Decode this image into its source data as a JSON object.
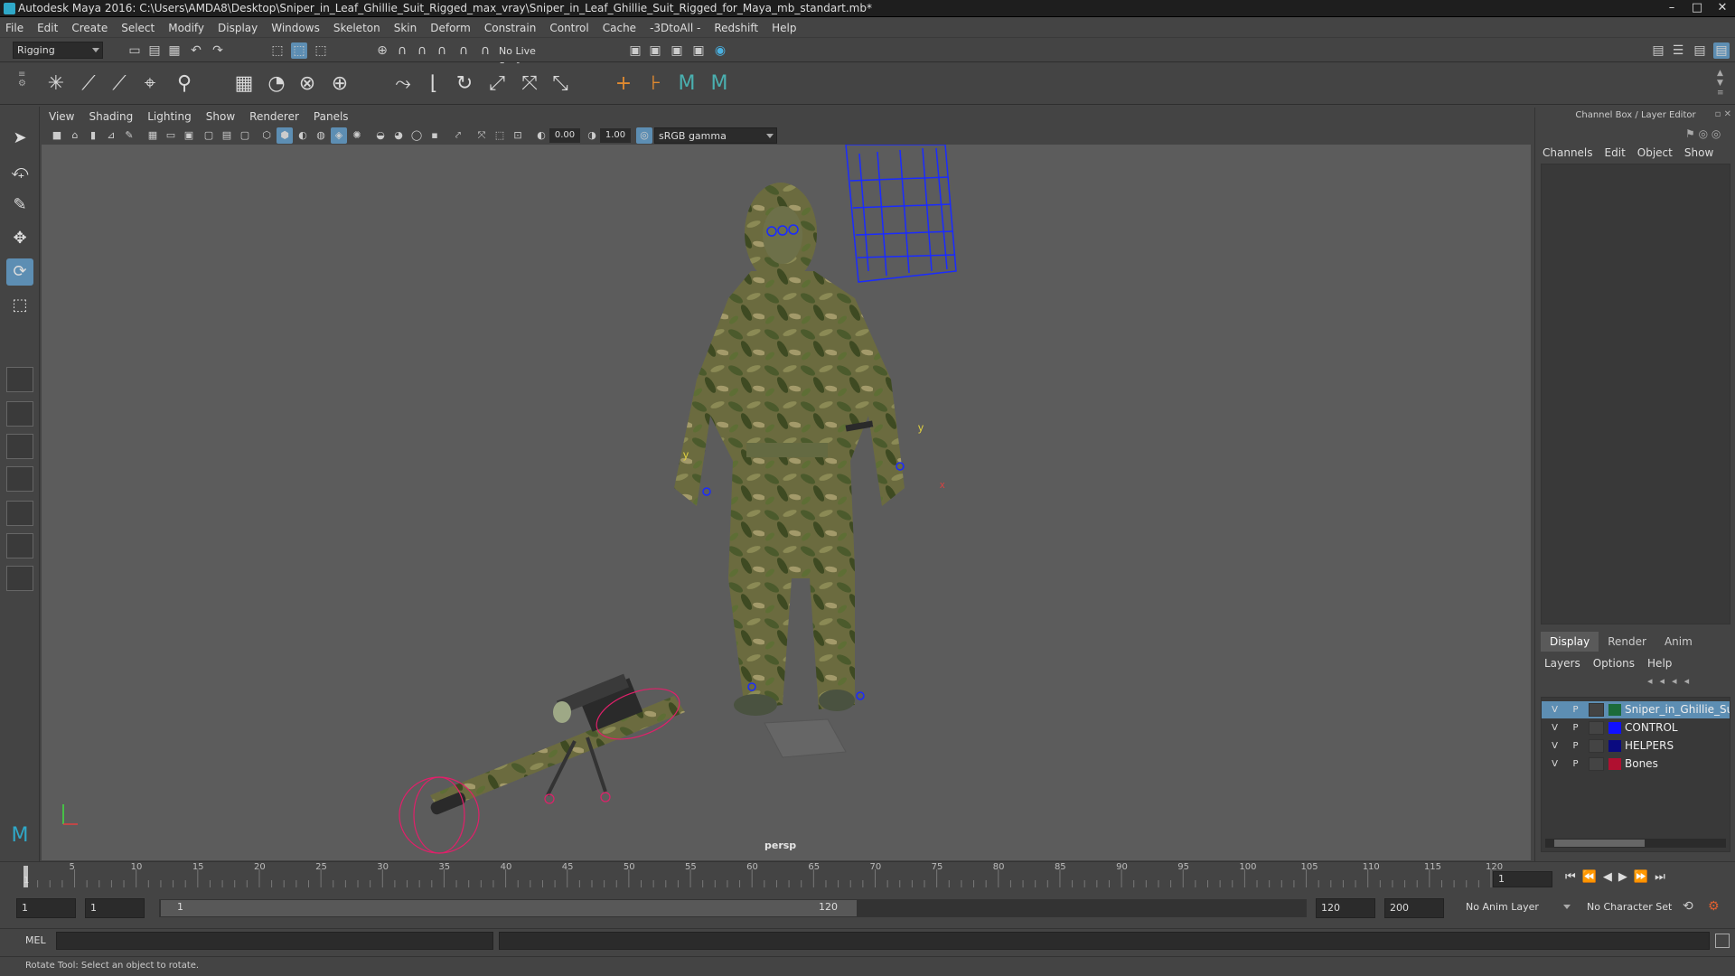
{
  "window": {
    "title": "Autodesk Maya 2016: C:\\Users\\AMDA8\\Desktop\\Sniper_in_Leaf_Ghillie_Suit_Rigged_max_vray\\Sniper_in_Leaf_Ghillie_Suit_Rigged_for_Maya_mb_standart.mb*"
  },
  "menus": [
    "File",
    "Edit",
    "Create",
    "Select",
    "Modify",
    "Display",
    "Windows",
    "Skeleton",
    "Skin",
    "Deform",
    "Constrain",
    "Control",
    "Cache",
    "-3DtoAll -",
    "Redshift",
    "Help"
  ],
  "statusline": {
    "menuset": "Rigging",
    "live_surface": "No Live Surface"
  },
  "viewport": {
    "menus": [
      "View",
      "Shading",
      "Lighting",
      "Show",
      "Renderer",
      "Panels"
    ],
    "exposure": "0.00",
    "gamma": "1.00",
    "colorspace": "sRGB gamma",
    "camera_label": "persp",
    "axis_y": "y",
    "axis_x": "x"
  },
  "channelbox": {
    "header": "Channel Box / Layer Editor",
    "tabs": [
      "Channels",
      "Edit",
      "Object",
      "Show"
    ]
  },
  "layer_editor": {
    "tabs": [
      "Display",
      "Render",
      "Anim"
    ],
    "menus": [
      "Layers",
      "Options",
      "Help"
    ],
    "layers": [
      {
        "v": "V",
        "p": "P",
        "name": "Sniper_in_Ghillie_Suit",
        "color": "#1c6b3a",
        "selected": true
      },
      {
        "v": "V",
        "p": "P",
        "name": "CONTROL",
        "color": "#1010ff",
        "selected": false
      },
      {
        "v": "V",
        "p": "P",
        "name": "HELPERS",
        "color": "#0a0a80",
        "selected": false
      },
      {
        "v": "V",
        "p": "P",
        "name": "Bones",
        "color": "#b01030",
        "selected": false
      }
    ]
  },
  "timeline": {
    "ticks": [
      "5",
      "10",
      "15",
      "20",
      "25",
      "30",
      "35",
      "40",
      "45",
      "50",
      "55",
      "60",
      "65",
      "70",
      "75",
      "80",
      "85",
      "90",
      "95",
      "100",
      "105",
      "110",
      "115",
      "120"
    ],
    "current_marker": "1",
    "current_frame": "1"
  },
  "range": {
    "start_time": "1",
    "playback_start": "1",
    "range_start": "1",
    "range_end": "120",
    "playback_end": "120",
    "end_time": "200",
    "anim_layer": "No Anim Layer",
    "character_set": "No Character Set"
  },
  "cmdline": {
    "label": "MEL"
  },
  "helpline": {
    "text": "Rotate Tool: Select an object to rotate."
  }
}
